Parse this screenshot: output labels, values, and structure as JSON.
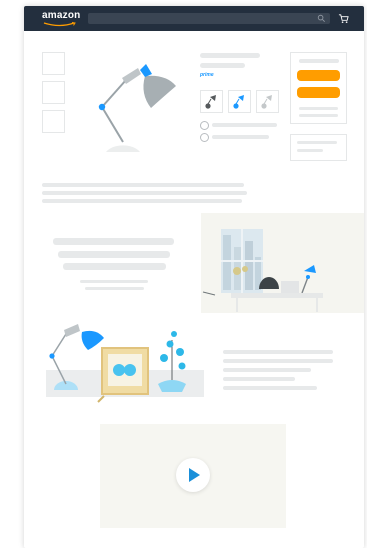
{
  "header": {
    "logo_text": "amazon",
    "search": {
      "placeholder": ""
    }
  },
  "product": {
    "prime_badge": "prime",
    "variants": [
      "lamp-variant-dark",
      "lamp-variant-blue",
      "lamp-variant-light"
    ]
  },
  "colors": {
    "topbar": "#232f3e",
    "accent_orange": "#ff9d00",
    "accent_blue": "#1a98ff",
    "placeholder_bar": "#e7e9ea"
  },
  "icons": [
    "search-icon",
    "cart-icon",
    "play-icon",
    "lamp-icon"
  ]
}
